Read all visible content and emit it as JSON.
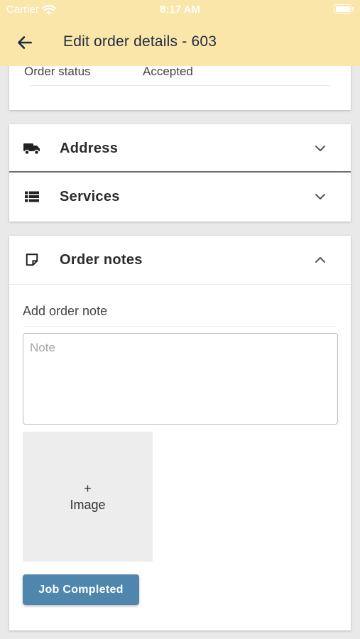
{
  "status_bar": {
    "carrier": "Carrier",
    "time": "8:17 AM"
  },
  "header": {
    "title": "Edit order details - 603",
    "back_icon": "arrow-left-icon"
  },
  "order_status": {
    "label": "Order status",
    "value": "Accepted"
  },
  "sections": {
    "address": {
      "label": "Address",
      "icon": "truck-icon",
      "expanded": false
    },
    "services": {
      "label": "Services",
      "icon": "list-icon",
      "expanded": false
    },
    "order_notes": {
      "label": "Order notes",
      "icon": "sticky-note-icon",
      "expanded": true
    }
  },
  "notes": {
    "add_label": "Add order note",
    "placeholder": "Note",
    "image_plus": "+",
    "image_label": "Image",
    "submit_label": "Job Completed"
  },
  "colors": {
    "header_bg": "#fae6a8",
    "primary_button": "#4f86ae",
    "page_bg": "#e9e9e9"
  }
}
